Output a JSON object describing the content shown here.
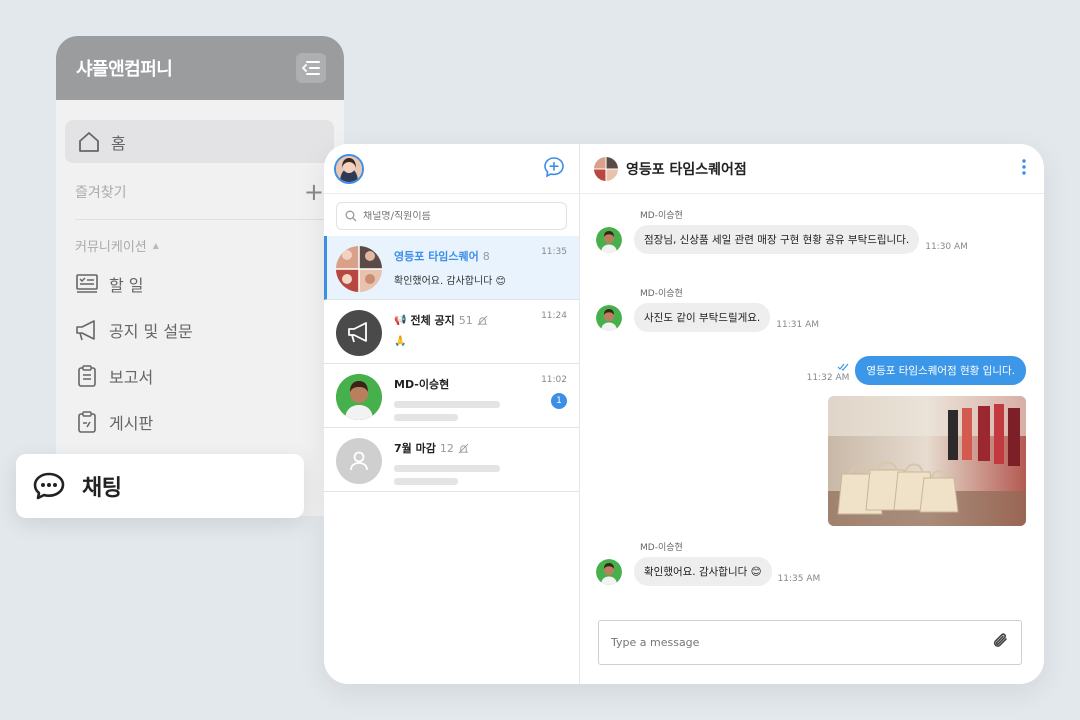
{
  "sidebar": {
    "company": "샤플앤컴퍼니",
    "home": "홈",
    "favorites": "즐겨찾기",
    "section": "커뮤니케이션",
    "items": [
      {
        "label": "할 일"
      },
      {
        "label": "공지 및 설문"
      },
      {
        "label": "보고서"
      },
      {
        "label": "게시판"
      }
    ],
    "chat": "채팅"
  },
  "list": {
    "search_placeholder": "채널명/직원이름",
    "rooms": [
      {
        "name": "영등포 타임스퀘어",
        "count": "8",
        "time": "11:35",
        "last": "확인했어요. 감사합니다 😊"
      },
      {
        "name": "전체 공지",
        "count": "51",
        "time": "11:24",
        "last": "🙏"
      },
      {
        "name": "MD-이승현",
        "count": "",
        "time": "11:02",
        "unread": "1"
      },
      {
        "name": "7월 마감",
        "count": "12",
        "time": ""
      }
    ]
  },
  "conversation": {
    "title": "영등포 타임스퀘어점",
    "messages": [
      {
        "sender": "MD-이승현",
        "text": "점장님, 신상품 세일 관련 매장 구현 현황 공유 부탁드립니다.",
        "time": "11:30 AM"
      },
      {
        "sender": "MD-이승현",
        "text": "사진도 같이 부탁드릴게요.",
        "time": "11:31 AM"
      },
      {
        "mine": true,
        "text": "영등포 타임스퀘어점 현황 입니다.",
        "time": "11:32 AM"
      },
      {
        "sender": "MD-이승현",
        "text": "확인했어요. 감사합니다 😊",
        "time": "11:35 AM"
      }
    ],
    "composer_placeholder": "Type a message"
  },
  "colors": {
    "accent": "#3d8fe6",
    "sidebar_header": "#9b9c9e",
    "background": "#e3e8ed"
  }
}
